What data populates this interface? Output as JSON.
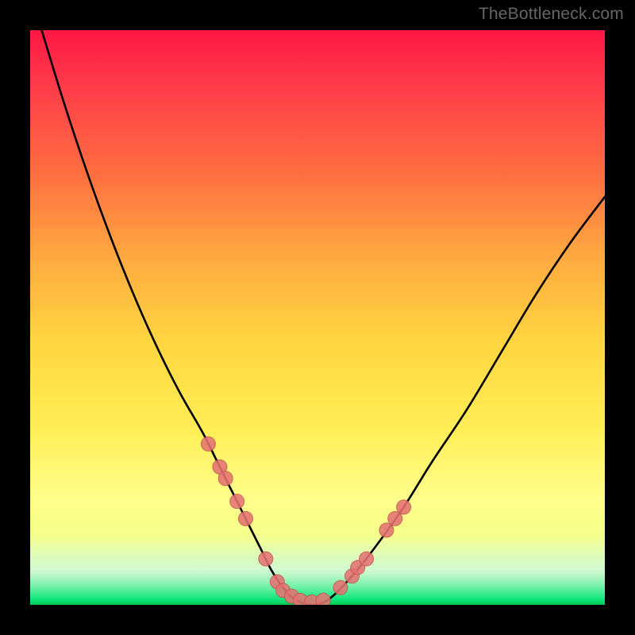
{
  "watermark": "TheBottleneck.com",
  "chart_data": {
    "type": "line",
    "title": "",
    "xlabel": "",
    "ylabel": "",
    "xlim": [
      0,
      100
    ],
    "ylim": [
      0,
      100
    ],
    "grid": false,
    "series": [
      {
        "name": "curve",
        "x": [
          2,
          6,
          10,
          14,
          18,
          22,
          26,
          30,
          33,
          36,
          38,
          40,
          42,
          44,
          46,
          49,
          52,
          56,
          60,
          65,
          70,
          76,
          82,
          88,
          94,
          100
        ],
        "values": [
          100,
          87,
          75,
          64,
          54,
          45,
          37,
          30,
          24,
          18,
          14,
          10,
          6,
          3,
          1,
          0,
          1,
          5,
          10,
          17,
          25,
          34,
          44,
          54,
          63,
          71
        ]
      }
    ],
    "markers": {
      "name": "data-points",
      "x": [
        31,
        33,
        34,
        36,
        37.5,
        41,
        43,
        44,
        45.5,
        47,
        49,
        51,
        54,
        56,
        57,
        58.5,
        62,
        63.5,
        65
      ],
      "values": [
        28,
        24,
        22,
        18,
        15,
        8,
        4,
        2.5,
        1.5,
        0.8,
        0.5,
        0.8,
        3,
        5,
        6.5,
        8,
        13,
        15,
        17
      ]
    },
    "annotations": []
  },
  "colors": {
    "curve_stroke": "#000000",
    "marker_fill": "#e57373",
    "marker_stroke": "#c0574f",
    "background_frame": "#000000"
  }
}
